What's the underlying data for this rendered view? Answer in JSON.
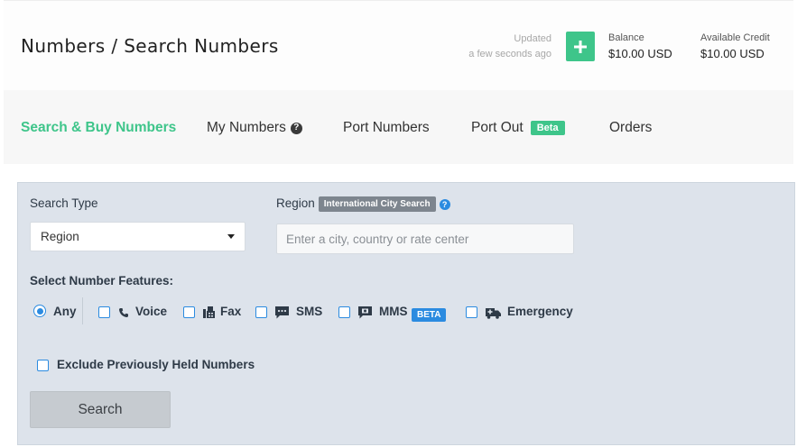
{
  "header": {
    "title": "Numbers / Search Numbers",
    "updated_label": "Updated",
    "updated_time": "a few seconds ago",
    "add_icon": "plus-icon",
    "balance": {
      "label": "Balance",
      "value": "$10.00 USD"
    },
    "credit": {
      "label": "Available Credit",
      "value": "$10.00 USD"
    }
  },
  "tabs": [
    {
      "label": "Search & Buy Numbers",
      "active": true
    },
    {
      "label": "My Numbers",
      "icon": "question-circle-icon"
    },
    {
      "label": "Port Numbers"
    },
    {
      "label": "Port Out",
      "badge": "Beta"
    },
    {
      "label": "Orders"
    }
  ],
  "search": {
    "search_type_label": "Search Type",
    "search_type_value": "Region",
    "region_label": "Region",
    "region_badge": "International City Search",
    "region_help_icon": "help-circle-icon",
    "region_placeholder": "Enter a city, country or rate center",
    "features_label": "Select Number Features:",
    "features": {
      "any": "Any",
      "voice": "Voice",
      "fax": "Fax",
      "sms": "SMS",
      "mms": "MMS",
      "mms_badge": "BETA",
      "emergency": "Emergency"
    },
    "exclude_label": "Exclude Previously Held Numbers",
    "search_button": "Search"
  },
  "colors": {
    "accent_green": "#3ec58a",
    "accent_blue": "#2b8be0",
    "panel_bg": "#dde3eb"
  }
}
